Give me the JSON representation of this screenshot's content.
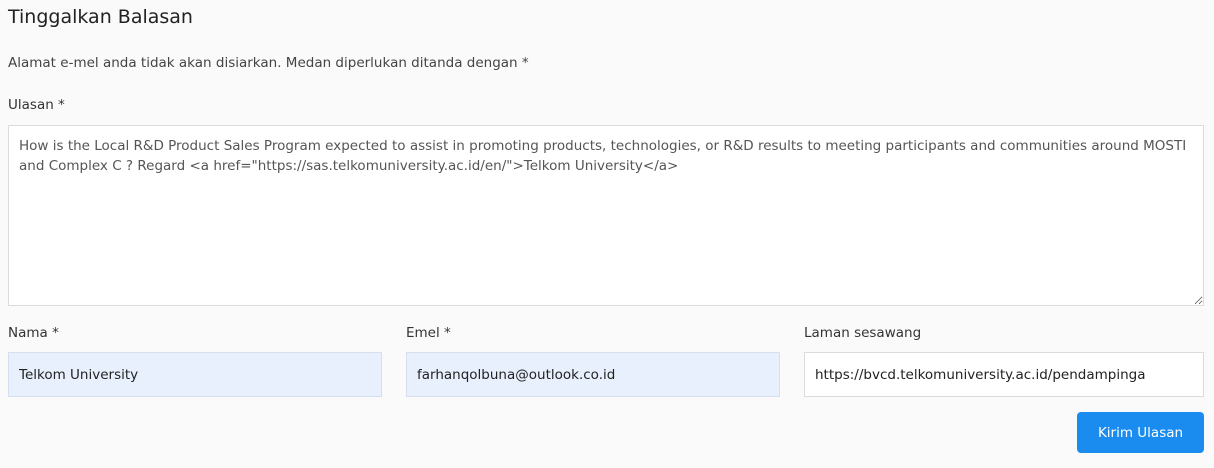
{
  "reply": {
    "title": "Tinggalkan Balasan",
    "notes": "Alamat e-mel anda tidak akan disiarkan. Medan diperlukan ditanda dengan *",
    "comment": {
      "label": "Ulasan *",
      "value": "How is the Local R&D Product Sales Program expected to assist in promoting products, technologies, or R&D results to meeting participants and communities around MOSTI and Complex C ? Regard <a href=\"https://sas.telkomuniversity.ac.id/en/\">Telkom University</a>"
    },
    "name": {
      "label": "Nama *",
      "value": "Telkom University"
    },
    "email": {
      "label": "Emel *",
      "value": "farhanqolbuna@outlook.co.id"
    },
    "website": {
      "label": "Laman sesawang",
      "value": "https://bvcd.telkomuniversity.ac.id/pendampinga"
    },
    "submit_label": "Kirim Ulasan"
  },
  "colors": {
    "accent": "#1a8cf0",
    "autofill_bg": "#e8f0fe",
    "page_bg": "#fafafa"
  }
}
